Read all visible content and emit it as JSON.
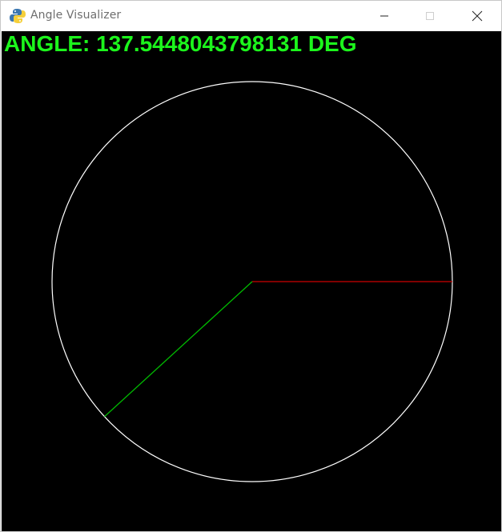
{
  "window": {
    "title": "Angle Visualizer",
    "icon": "python-snake-icon"
  },
  "readout": {
    "text": "ANGLE: 137.5448043798131 DEG"
  },
  "visualization": {
    "angle_deg": 137.5448043798131,
    "circle_color": "#ffffff",
    "reference_ray_color": "#cc0000",
    "angle_ray_color": "#00bb00",
    "background_color": "#000000",
    "text_color": "#1cf51c"
  }
}
